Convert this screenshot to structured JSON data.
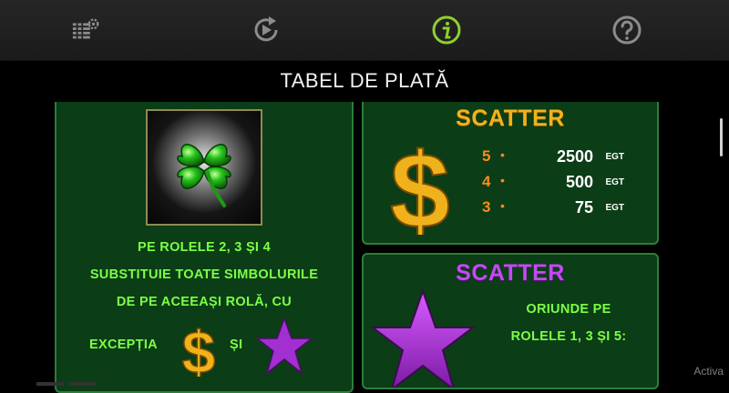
{
  "toolbar": {
    "icons": [
      "settings-icon",
      "autoplay-icon",
      "info-icon",
      "help-icon"
    ],
    "active": "info-icon",
    "active_color": "#8fcf2e"
  },
  "page": {
    "title": "TABEL DE PLATĂ"
  },
  "wild_panel": {
    "line1": "PE ROLELE 2, 3 ȘI 4",
    "line2": "SUBSTITUIE TOATE SIMBOLURILE",
    "line3": "DE PE ACEEAȘI ROLĂ, CU",
    "exception_label": "EXCEPȚIA",
    "and_label": "ȘI"
  },
  "dollar_scatter": {
    "title": "SCATTER",
    "payouts": [
      {
        "count": "5",
        "value": "2500",
        "unit": "EGT"
      },
      {
        "count": "4",
        "value": "500",
        "unit": "EGT"
      },
      {
        "count": "3",
        "value": "75",
        "unit": "EGT"
      }
    ]
  },
  "star_scatter": {
    "title": "SCATTER",
    "line1": "ORIUNDE PE",
    "line2": "ROLELE 1, 3 ȘI 5:"
  },
  "colors": {
    "panel_bg": "#0b3d16",
    "panel_border": "#2f7d3c",
    "text_green": "#7cff45",
    "gold": "#f3b21b",
    "purple": "#c24bf0",
    "count_orange": "#ff8a1c"
  },
  "watermark": "Activa"
}
